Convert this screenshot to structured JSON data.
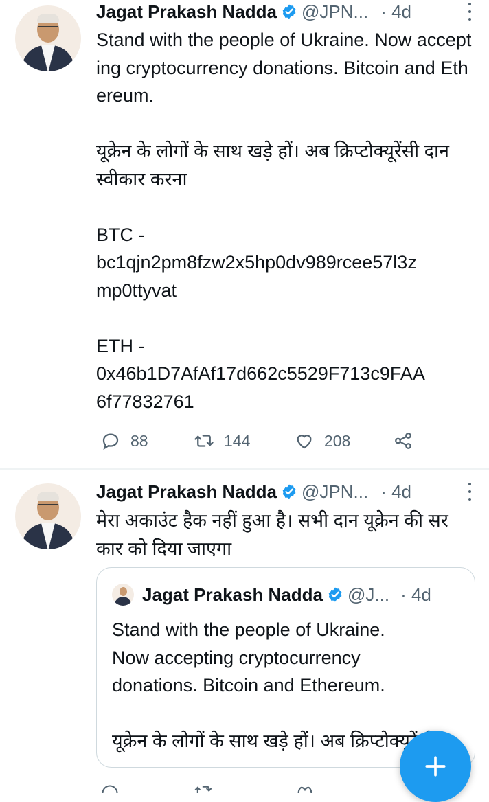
{
  "tweets": [
    {
      "author": {
        "name": "Jagat Prakash Nadda",
        "handle": "@JPN...",
        "verified": true
      },
      "time": "· 4d",
      "text": "Stand with the people of Ukraine. Now accepting cryptocurrency donations. Bitcoin and Ethereum.\n\nयूक्रेन के लोगों के साथ खड़े हों। अब क्रिप्टोक्यूरेंसी दान स्वीकार करना\n\nBTC -\nbc1qjn2pm8fzw2x5hp0dv989rcee57l3z\nmp0ttyvat\n\nETH -\n0x46b1D7AfAf17d662c5529F713c9FAA\n6f77832761",
      "actions": {
        "replies": "88",
        "retweets": "144",
        "likes": "208"
      }
    },
    {
      "author": {
        "name": "Jagat Prakash Nadda",
        "handle": "@JPN...",
        "verified": true
      },
      "time": "· 4d",
      "text": "मेरा अकाउंट हैक नहीं हुआ है। सभी दान यूक्रेन की सरकार को दिया जाएगा",
      "quote": {
        "author": {
          "name": "Jagat Prakash Nadda",
          "handle": "@J...",
          "verified": true
        },
        "time": "· 4d",
        "text": "Stand with the people of Ukraine.\nNow accepting cryptocurrency\ndonations. Bitcoin and Ethereum.\n\nयूक्रेन के लोगों के साथ खड़े हों। अब क्रिप्टोक्यूरेंसी"
      }
    }
  ],
  "icons": {
    "verified": "verified-badge-icon",
    "more": "more-options-icon",
    "reply": "reply-icon",
    "retweet": "retweet-icon",
    "like": "like-icon",
    "share": "share-icon",
    "compose": "compose-plus-icon"
  },
  "colors": {
    "accent": "#1d9bf0",
    "muted": "#536471",
    "text": "#0f1419",
    "border": "#cfd9de"
  }
}
